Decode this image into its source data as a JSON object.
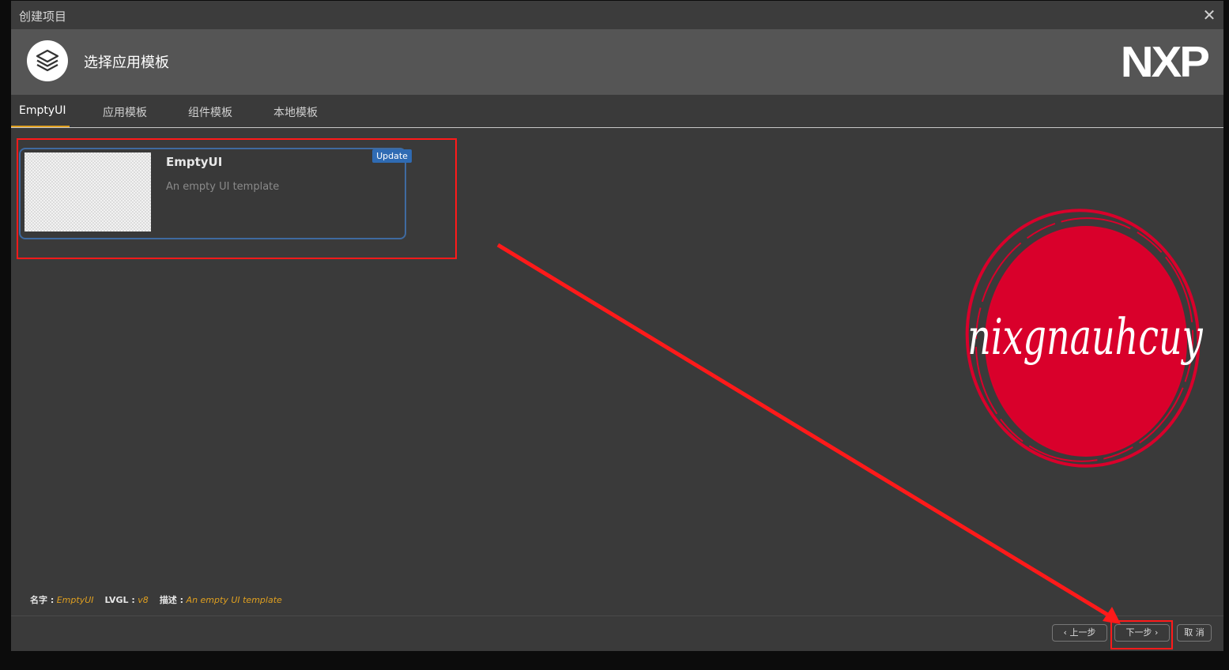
{
  "window": {
    "title": "创建项目",
    "close_icon": "close-icon"
  },
  "banner": {
    "heading": "选择应用模板",
    "brand": "NXP",
    "logo_icon": "layers-icon"
  },
  "tabs": [
    {
      "label": "EmptyUI",
      "active": true
    },
    {
      "label": "应用模板"
    },
    {
      "label": "组件模板"
    },
    {
      "label": "本地模板"
    }
  ],
  "template_card": {
    "name": "EmptyUI",
    "description": "An empty UI template",
    "badge": "Update"
  },
  "info": {
    "name_key": "名字 :",
    "name_value": "EmptyUI",
    "lvgl_key": "LVGL :",
    "lvgl_value": "v8",
    "desc_key": "描述 :",
    "desc_value": "An empty UI template"
  },
  "buttons": {
    "prev": "上一步",
    "next": "下一步",
    "cancel": "取 消"
  },
  "watermark": {
    "text": "nixgnauhcuy",
    "color": "#d9002b"
  },
  "colors": {
    "accent": "#e0a020",
    "highlight": "#ff1a1a",
    "badge": "#2f6bb3"
  }
}
